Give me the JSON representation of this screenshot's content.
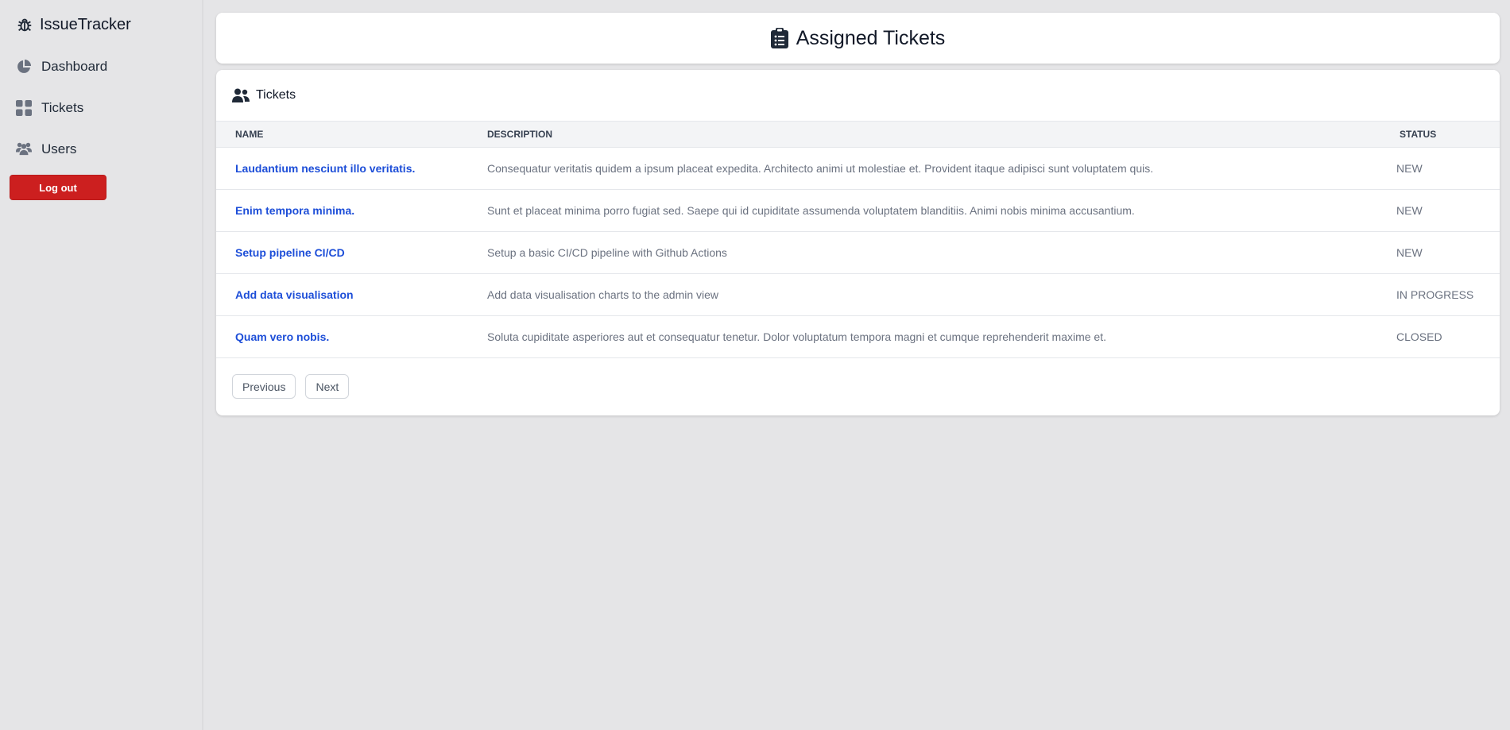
{
  "app": {
    "title": "IssueTracker"
  },
  "sidebar": {
    "items": [
      {
        "label": "Dashboard",
        "icon": "pie-chart-icon"
      },
      {
        "label": "Tickets",
        "icon": "grid-icon"
      },
      {
        "label": "Users",
        "icon": "users-icon"
      }
    ],
    "logout_label": "Log out"
  },
  "header": {
    "title": "Assigned Tickets",
    "icon": "clipboard-icon"
  },
  "tickets": {
    "title": "Tickets",
    "icon": "users-icon",
    "columns": {
      "name": "NAME",
      "description": "DESCRIPTION",
      "status": "STATUS"
    },
    "rows": [
      {
        "name": "Laudantium nesciunt illo veritatis.",
        "description": "Consequatur veritatis quidem a ipsum placeat expedita. Architecto animi ut molestiae et. Provident itaque adipisci sunt voluptatem quis.",
        "status": "NEW"
      },
      {
        "name": "Enim tempora minima.",
        "description": "Sunt et placeat minima porro fugiat sed. Saepe qui id cupiditate assumenda voluptatem blanditiis. Animi nobis minima accusantium.",
        "status": "NEW"
      },
      {
        "name": "Setup pipeline CI/CD",
        "description": "Setup a basic CI/CD pipeline with Github Actions",
        "status": "NEW"
      },
      {
        "name": "Add data visualisation",
        "description": "Add data visualisation charts to the admin view",
        "status": "IN PROGRESS"
      },
      {
        "name": "Quam vero nobis.",
        "description": "Soluta cupiditate asperiores aut et consequatur tenetur. Dolor voluptatum tempora magni et cumque reprehenderit maxime et.",
        "status": "CLOSED"
      }
    ],
    "pagination": {
      "previous_label": "Previous",
      "next_label": "Next"
    }
  },
  "colors": {
    "link": "#1d4ed8",
    "logout": "#cc1f1f",
    "background": "#e5e5e7"
  }
}
